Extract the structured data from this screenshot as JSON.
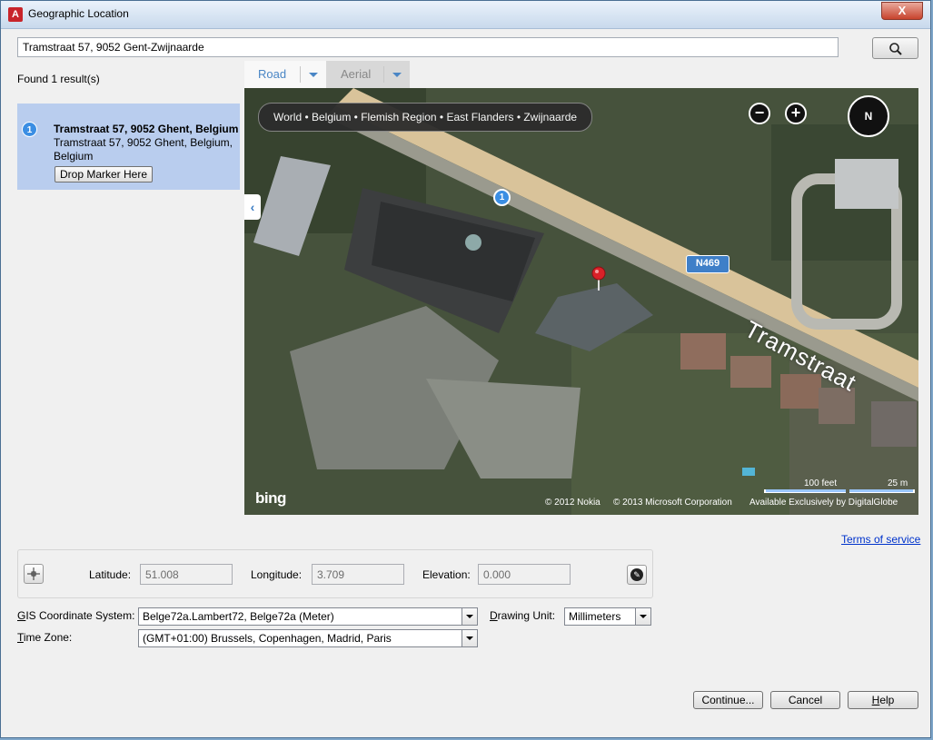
{
  "window": {
    "title": "Geographic Location",
    "close_label": "X",
    "app_icon_letter": "A"
  },
  "search": {
    "value": "Tramstraat 57, 9052 Gent-Zwijnaarde"
  },
  "results": {
    "found_text": "Found 1 result(s)",
    "items": [
      {
        "number": "1",
        "title": "Tramstraat 57, 9052 Ghent, Belgium",
        "address": "Tramstraat 57, 9052 Ghent, Belgium, Belgium",
        "drop_marker_label": "Drop Marker Here"
      }
    ]
  },
  "map": {
    "tabs": [
      {
        "label": "Road"
      },
      {
        "label": "Aerial"
      }
    ],
    "breadcrumb": "World • Belgium • Flemish Region • East Flanders • Zwijnaarde",
    "compass_label": "N",
    "zoom_out_label": "−",
    "zoom_in_label": "+",
    "collapse_label": "‹",
    "road_label": "N469",
    "street_label": "Tramstraat",
    "pin_number": "1",
    "logo": "bing",
    "copyright_1": "© 2012 Nokia",
    "copyright_2": "© 2013 Microsoft Corporation",
    "copyright_3": "Available Exclusively by DigitalGlobe",
    "scale_feet": "100 feet",
    "scale_meters": "25 m"
  },
  "terms_label": "Terms of service",
  "coordinates": {
    "latitude_label": "Latitude:",
    "latitude": "51.008",
    "longitude_label": "Longitude:",
    "longitude": "3.709",
    "elevation_label": "Elevation:",
    "elevation": "0.000"
  },
  "gis": {
    "label_prefix": "G",
    "label_rest": "IS Coordinate System:",
    "value": "Belge72a.Lambert72, Belge72a (Meter)",
    "drawing_unit_label_prefix": "D",
    "drawing_unit_label_rest": "rawing Unit:",
    "drawing_unit": "Millimeters",
    "time_zone_label_prefix": "T",
    "time_zone_label_rest": "ime Zone:",
    "time_zone": "(GMT+01:00) Brussels, Copenhagen, Madrid, Paris"
  },
  "buttons": {
    "continue": "Continue...",
    "cancel": "Cancel",
    "help_prefix": "H",
    "help_rest": "elp"
  },
  "colors": {
    "accent": "#3b8ee3",
    "selection": "#b9cdee",
    "pin": "#d92128"
  }
}
